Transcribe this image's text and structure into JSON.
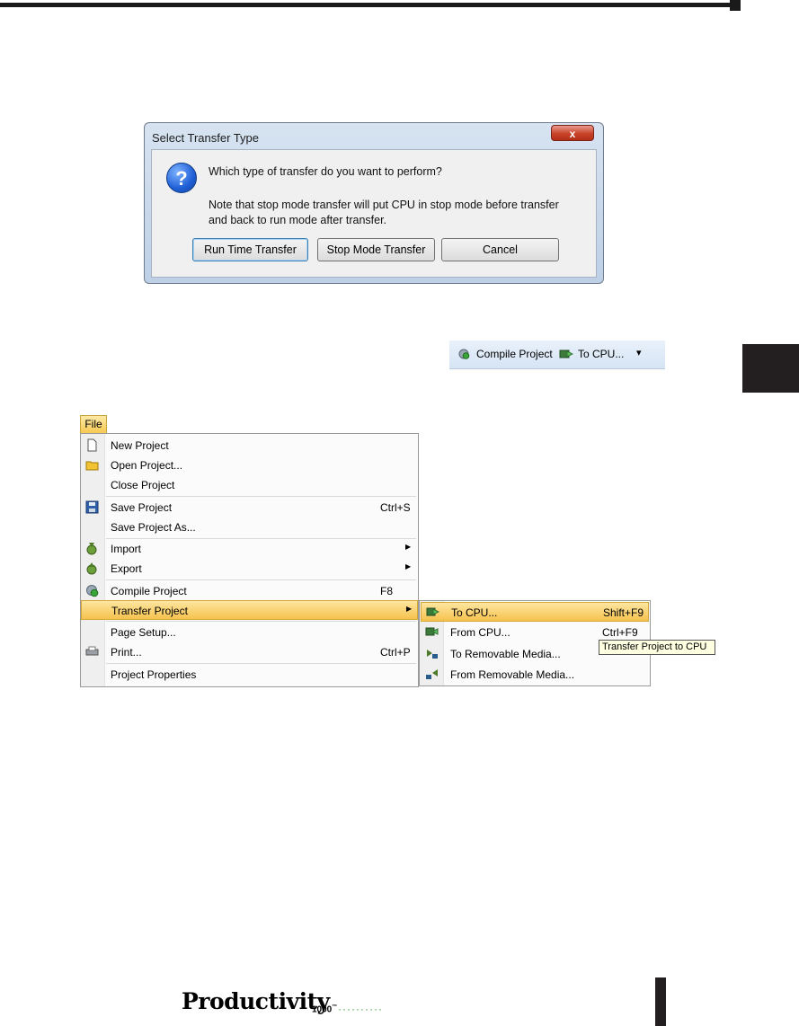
{
  "dialog": {
    "title": "Select Transfer Type",
    "close_glyph": "x",
    "question": "Which type of transfer do you want to perform?",
    "note_line1": "Note that stop mode transfer will put CPU in stop mode before transfer",
    "note_line2": "and back to run mode after transfer.",
    "buttons": {
      "run": "Run Time Transfer",
      "stop": "Stop Mode Transfer",
      "cancel": "Cancel"
    },
    "icon": "question-icon"
  },
  "toolbar": {
    "compile": "Compile Project",
    "to_cpu": "To CPU...",
    "dropdown": "▾"
  },
  "file_menu": {
    "tab": "File",
    "items": [
      {
        "label": "New Project",
        "shortcut": "",
        "icon": "new-document-icon"
      },
      {
        "label": "Open Project...",
        "shortcut": "",
        "icon": "open-folder-icon"
      },
      {
        "label": "Close Project",
        "shortcut": ""
      },
      {
        "label": "Save Project",
        "shortcut": "Ctrl+S",
        "icon": "floppy-disk-icon"
      },
      {
        "label": "Save Project As...",
        "shortcut": ""
      },
      {
        "label": "Import",
        "shortcut": "",
        "submenu": true,
        "icon": "import-icon"
      },
      {
        "label": "Export",
        "shortcut": "",
        "submenu": true,
        "icon": "export-icon"
      },
      {
        "label": "Compile Project",
        "shortcut": "F8",
        "icon": "compile-gear-icon"
      },
      {
        "label": "Transfer Project",
        "shortcut": "",
        "submenu": true,
        "highlighted": true
      },
      {
        "label": "Page Setup...",
        "shortcut": ""
      },
      {
        "label": "Print...",
        "shortcut": "Ctrl+P",
        "icon": "printer-icon"
      },
      {
        "label": "Project Properties",
        "shortcut": ""
      }
    ],
    "submenu_arrow": "▶"
  },
  "transfer_submenu": {
    "items": [
      {
        "label": "To CPU...",
        "shortcut": "Shift+F9",
        "highlighted": true,
        "icon": "to-cpu-icon"
      },
      {
        "label": "From CPU...",
        "shortcut": "Ctrl+F9",
        "icon": "from-cpu-icon"
      },
      {
        "label": "To Removable Media...",
        "shortcut": "",
        "icon": "to-media-icon"
      },
      {
        "label": "From Removable Media...",
        "shortcut": "",
        "icon": "from-media-icon"
      }
    ],
    "tooltip": "Transfer Project to CPU"
  },
  "footer": {
    "brand": "Productivity",
    "model": "1000",
    "tm": "™",
    "dots": "··········"
  },
  "colors": {
    "highlight": "#f6c24e",
    "dialog_frame": "#bdd0e6",
    "close_button": "#c8432a"
  }
}
